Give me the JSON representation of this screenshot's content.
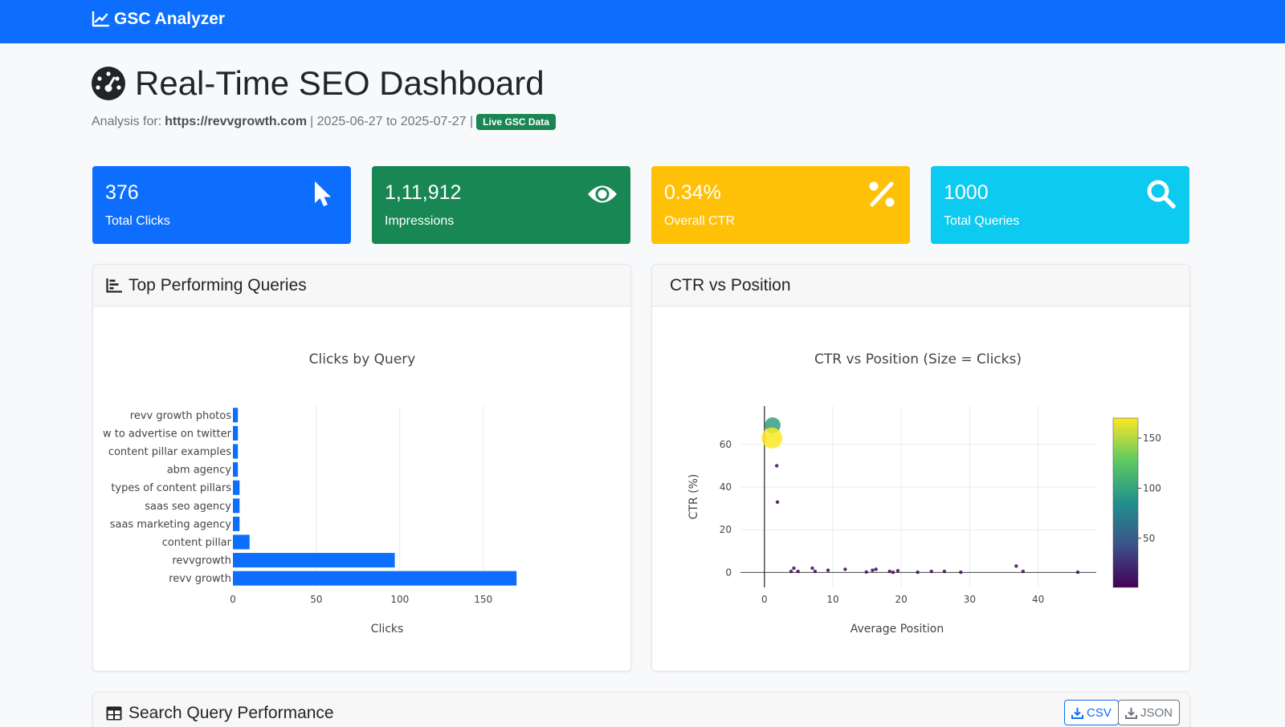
{
  "navbar": {
    "brand": "GSC Analyzer"
  },
  "header": {
    "title": "Real-Time SEO Dashboard",
    "analysis_prefix": "Analysis for:",
    "site": "https://revvgrowth.com",
    "date_range": "| 2025-06-27 to 2025-07-27 |",
    "badge": "Live GSC Data"
  },
  "stats": [
    {
      "value": "376",
      "label": "Total Clicks",
      "color": "#0d6efd",
      "icon": "cursor-icon"
    },
    {
      "value": "1,11,912",
      "label": "Impressions",
      "color": "#198754",
      "icon": "eye-icon"
    },
    {
      "value": "0.34%",
      "label": "Overall CTR",
      "color": "#ffc107",
      "icon": "percent-icon"
    },
    {
      "value": "1000",
      "label": "Total Queries",
      "color": "#0dcaf0",
      "icon": "search-icon"
    }
  ],
  "cards": {
    "top_queries": "Top Performing Queries",
    "ctr_position": "CTR vs Position",
    "search_performance": "Search Query Performance"
  },
  "buttons": {
    "csv": "CSV",
    "json": "JSON"
  },
  "chart_data": [
    {
      "type": "bar",
      "orientation": "horizontal",
      "title": "Clicks by Query",
      "xlabel": "Clicks",
      "ylabel": "",
      "xlim": [
        0,
        180
      ],
      "xticks": [
        0,
        50,
        100,
        150
      ],
      "color": "#0d6efd",
      "categories": [
        "revv growth",
        "revvgrowth",
        "content pillar",
        "saas marketing agency",
        "saas seo agency",
        "types of content pillars",
        "abm agency",
        "content pillar examples",
        "w to advertise on twitter",
        "revv growth photos"
      ],
      "values": [
        170,
        97,
        10,
        4,
        4,
        4,
        3,
        3,
        3,
        3
      ]
    },
    {
      "type": "scatter",
      "title": "CTR vs Position (Size = Clicks)",
      "xlabel": "Average Position",
      "ylabel": "CTR (%)",
      "xlim": [
        -3.5,
        48.5
      ],
      "ylim": [
        -7,
        78
      ],
      "xticks": [
        0,
        10,
        20,
        30,
        40
      ],
      "yticks": [
        0,
        20,
        40,
        60
      ],
      "colorscale": "viridis",
      "colorbar_range": [
        1,
        170
      ],
      "colorbar_ticks": [
        50,
        100,
        150
      ],
      "points": [
        {
          "x": 1.1,
          "y": 63,
          "clicks": 170
        },
        {
          "x": 1.2,
          "y": 69,
          "clicks": 97
        },
        {
          "x": 1.8,
          "y": 50,
          "clicks": 3
        },
        {
          "x": 1.9,
          "y": 33,
          "clicks": 3
        },
        {
          "x": 3.9,
          "y": 0.5,
          "clicks": 3
        },
        {
          "x": 4.3,
          "y": 2,
          "clicks": 3
        },
        {
          "x": 4.9,
          "y": 0.5,
          "clicks": 3
        },
        {
          "x": 7.0,
          "y": 2,
          "clicks": 3
        },
        {
          "x": 7.4,
          "y": 0.5,
          "clicks": 3
        },
        {
          "x": 9.3,
          "y": 1,
          "clicks": 3
        },
        {
          "x": 11.8,
          "y": 1.5,
          "clicks": 3
        },
        {
          "x": 14.9,
          "y": 0.2,
          "clicks": 3
        },
        {
          "x": 15.8,
          "y": 1,
          "clicks": 3
        },
        {
          "x": 16.3,
          "y": 1.5,
          "clicks": 3
        },
        {
          "x": 18.3,
          "y": 0.5,
          "clicks": 3
        },
        {
          "x": 18.8,
          "y": 0.1,
          "clicks": 3
        },
        {
          "x": 19.5,
          "y": 0.8,
          "clicks": 3
        },
        {
          "x": 22.4,
          "y": 0.1,
          "clicks": 3
        },
        {
          "x": 24.4,
          "y": 0.5,
          "clicks": 3
        },
        {
          "x": 26.3,
          "y": 0.5,
          "clicks": 3
        },
        {
          "x": 28.7,
          "y": 0.1,
          "clicks": 3
        },
        {
          "x": 36.8,
          "y": 3,
          "clicks": 3
        },
        {
          "x": 37.8,
          "y": 0.5,
          "clicks": 3
        },
        {
          "x": 45.8,
          "y": 0.1,
          "clicks": 3
        }
      ]
    }
  ]
}
